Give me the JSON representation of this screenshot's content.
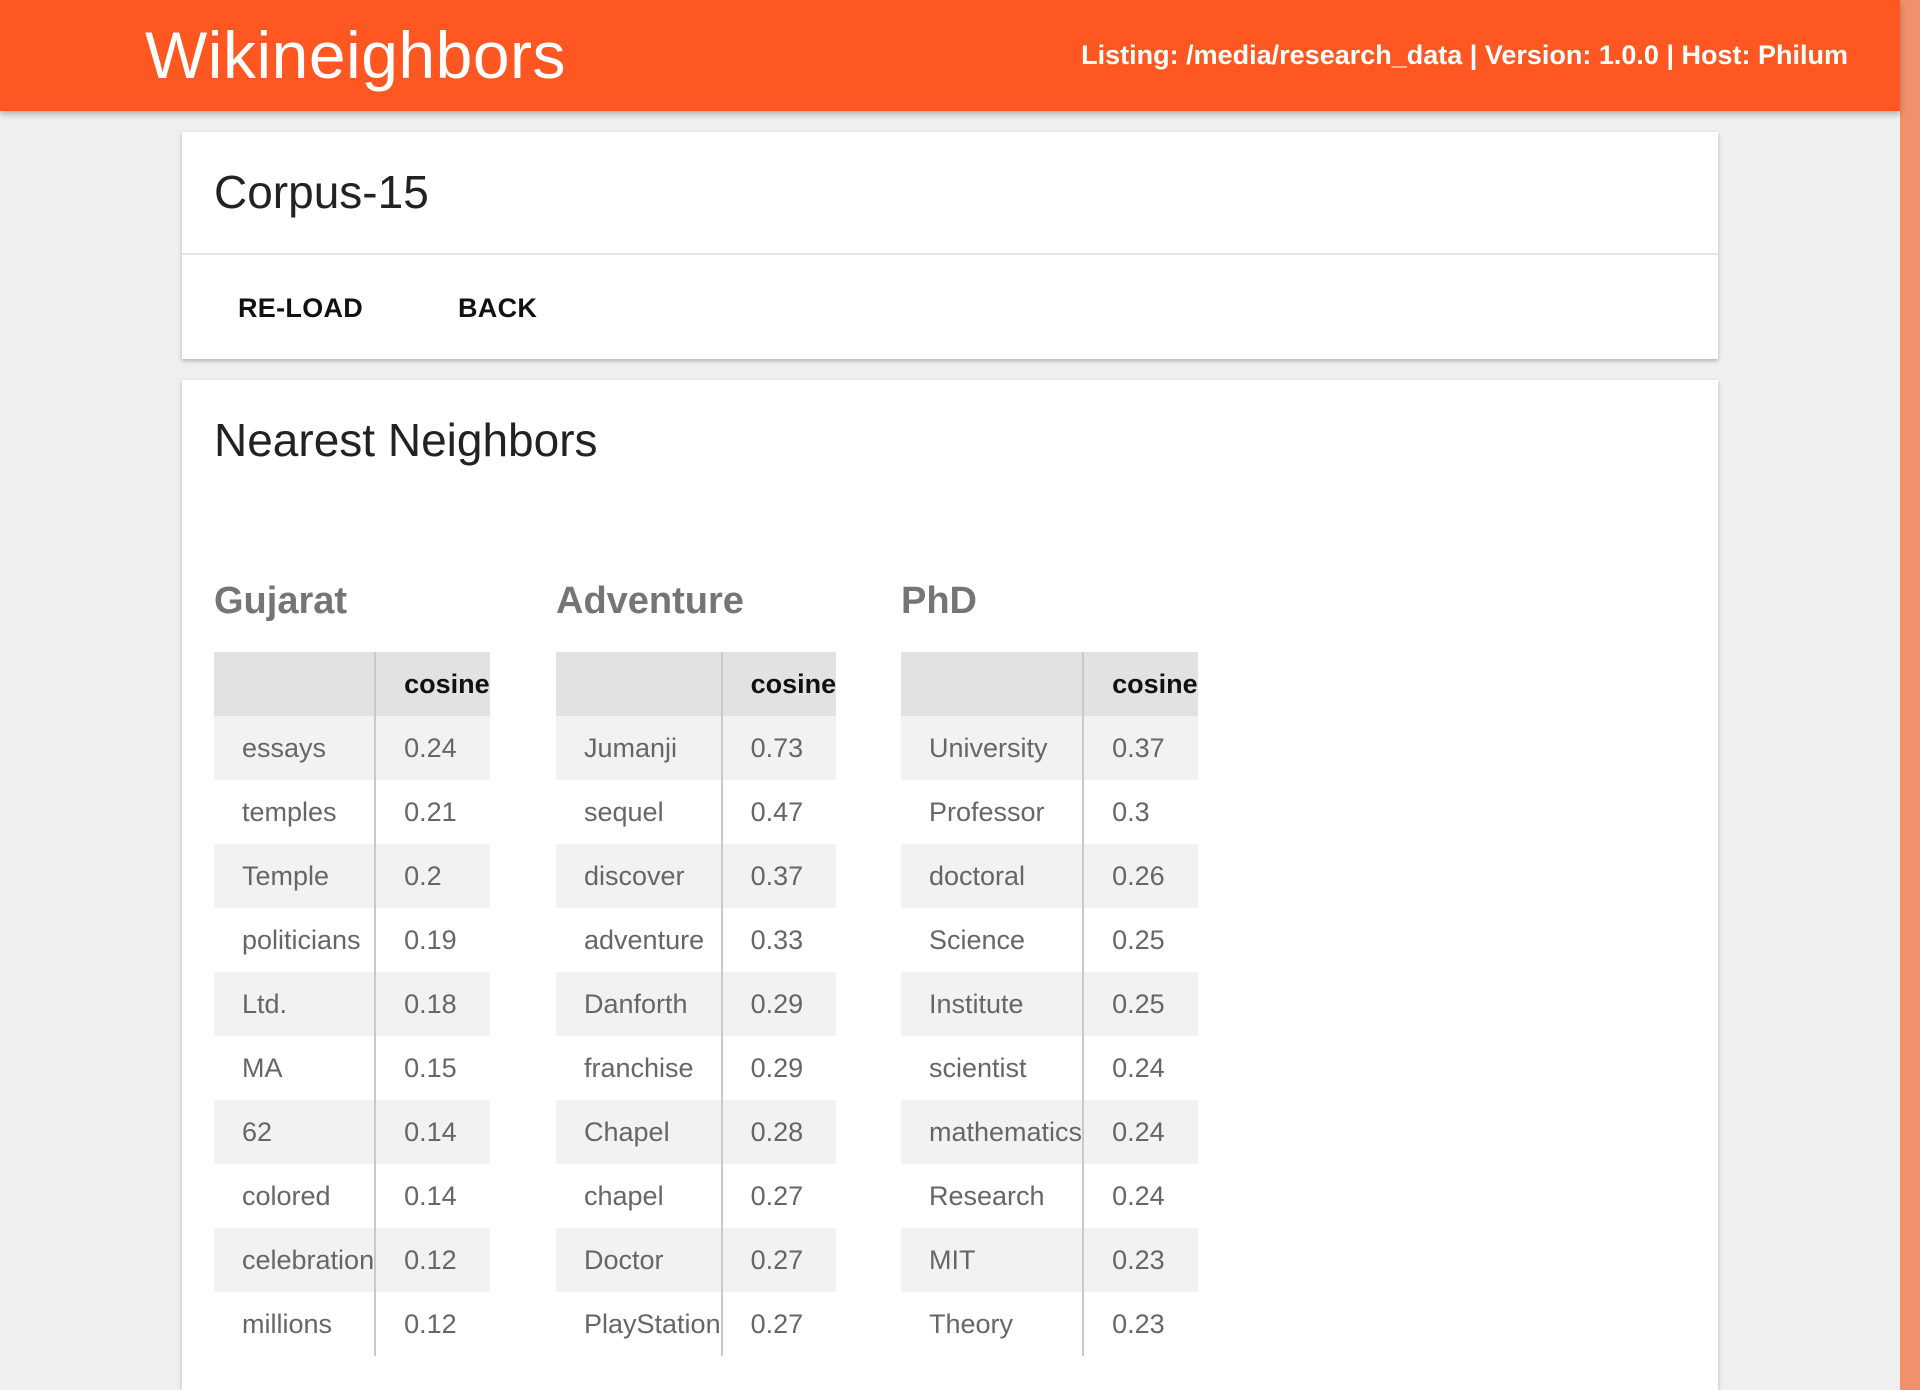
{
  "header": {
    "app_title": "Wikineighbors",
    "host_info": "Listing: /media/research_data | Version: 1.0.0 | Host: Philum",
    "accent_color": "#ff5722"
  },
  "corpus_card": {
    "title": "Corpus-15",
    "reload_label": "RE-LOAD",
    "back_label": "BACK"
  },
  "neighbors_card": {
    "title": "Nearest Neighbors",
    "groups": [
      {
        "title": "Gujarat",
        "col_word": "",
        "col_score": "cosine",
        "rows": [
          {
            "word": "essays",
            "score": "0.24"
          },
          {
            "word": "temples",
            "score": "0.21"
          },
          {
            "word": "Temple",
            "score": "0.2"
          },
          {
            "word": "politicians",
            "score": "0.19"
          },
          {
            "word": "Ltd.",
            "score": "0.18"
          },
          {
            "word": "MA",
            "score": "0.15"
          },
          {
            "word": "62",
            "score": "0.14"
          },
          {
            "word": "colored",
            "score": "0.14"
          },
          {
            "word": "celebration",
            "score": "0.12"
          },
          {
            "word": "millions",
            "score": "0.12"
          }
        ]
      },
      {
        "title": "Adventure",
        "col_word": "",
        "col_score": "cosine",
        "rows": [
          {
            "word": "Jumanji",
            "score": "0.73"
          },
          {
            "word": "sequel",
            "score": "0.47"
          },
          {
            "word": "discover",
            "score": "0.37"
          },
          {
            "word": "adventure",
            "score": "0.33"
          },
          {
            "word": "Danforth",
            "score": "0.29"
          },
          {
            "word": "franchise",
            "score": "0.29"
          },
          {
            "word": "Chapel",
            "score": "0.28"
          },
          {
            "word": "chapel",
            "score": "0.27"
          },
          {
            "word": "Doctor",
            "score": "0.27"
          },
          {
            "word": "PlayStation",
            "score": "0.27"
          }
        ]
      },
      {
        "title": "PhD",
        "col_word": "",
        "col_score": "cosine",
        "rows": [
          {
            "word": "University",
            "score": "0.37"
          },
          {
            "word": "Professor",
            "score": "0.3"
          },
          {
            "word": "doctoral",
            "score": "0.26"
          },
          {
            "word": "Science",
            "score": "0.25"
          },
          {
            "word": "Institute",
            "score": "0.25"
          },
          {
            "word": "scientist",
            "score": "0.24"
          },
          {
            "word": "mathematics",
            "score": "0.24"
          },
          {
            "word": "Research",
            "score": "0.24"
          },
          {
            "word": "MIT",
            "score": "0.23"
          },
          {
            "word": "Theory",
            "score": "0.23"
          }
        ]
      }
    ]
  }
}
